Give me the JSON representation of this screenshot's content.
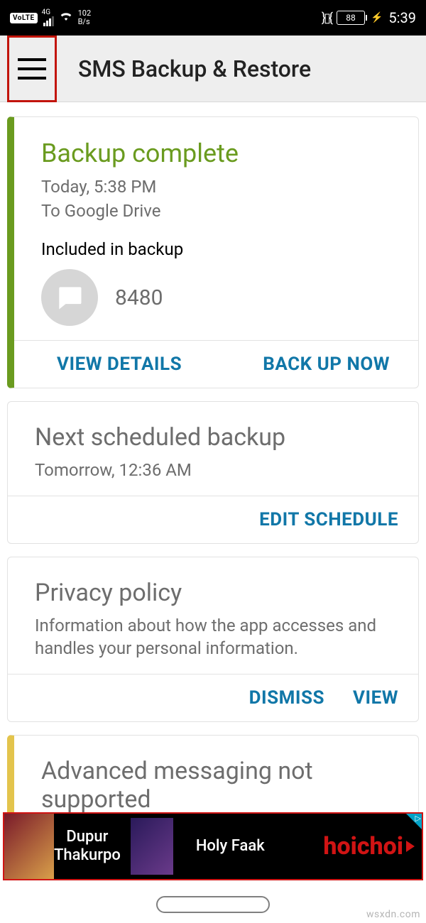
{
  "status": {
    "volte": "VoLTE",
    "net_gen": "4G",
    "speed_top": "102",
    "speed_unit": "B/s",
    "battery_pct": "88",
    "clock": "5:39"
  },
  "appbar": {
    "title": "SMS Backup & Restore"
  },
  "backup_card": {
    "title": "Backup complete",
    "time_line": "Today, 5:38 PM",
    "dest_line": "To Google Drive",
    "included_label": "Included in backup",
    "message_count": "8480",
    "view_details": "VIEW DETAILS",
    "back_up_now": "BACK UP NOW"
  },
  "schedule_card": {
    "title": "Next scheduled backup",
    "time_line": "Tomorrow, 12:36 AM",
    "edit_schedule": "EDIT SCHEDULE"
  },
  "privacy_card": {
    "title": "Privacy policy",
    "body": "Information about how the app accesses and handles your personal information.",
    "dismiss": "DISMISS",
    "view": "VIEW"
  },
  "advanced_card": {
    "title": "Advanced messaging not supported"
  },
  "ad": {
    "title1_line1": "Dupur",
    "title1_line2": "Thakurpo",
    "title2": "Holy Faak",
    "brand": "hoichoi"
  },
  "watermark": "wsxdn.com"
}
